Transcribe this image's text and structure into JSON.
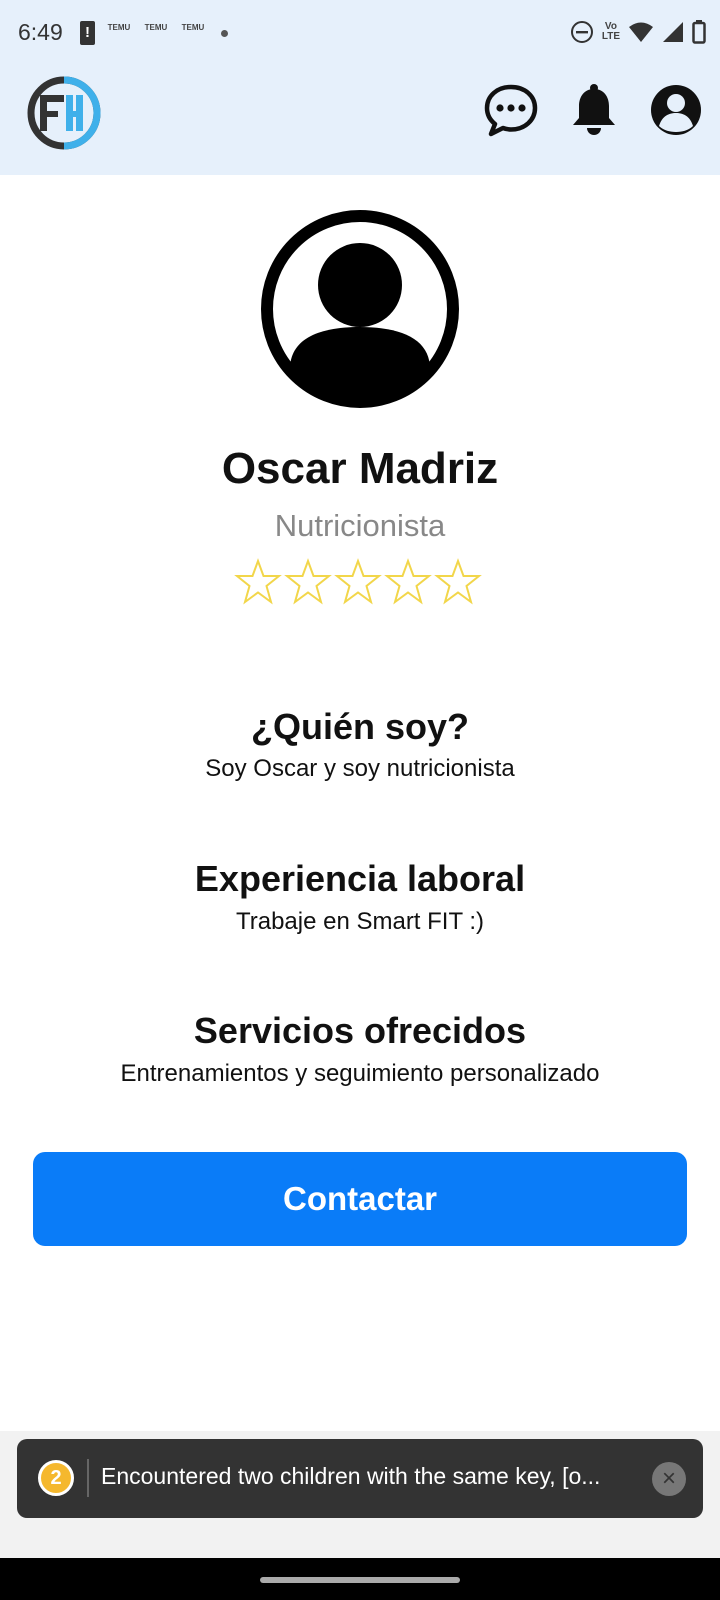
{
  "status_bar": {
    "time": "6:49",
    "battery_alert": "!",
    "temu_icon_label": "TEMU"
  },
  "header": {
    "logo_icon": "fh-logo-icon",
    "icons": [
      "chat-bubble-icon",
      "bell-icon",
      "user-circle-icon"
    ]
  },
  "profile": {
    "name": "Oscar Madriz",
    "role": "Nutricionista",
    "rating": 0,
    "rating_max": 5
  },
  "sections": {
    "about": {
      "title": "¿Quién soy?",
      "text": "Soy Oscar y soy nutricionista"
    },
    "experience": {
      "title": "Experiencia laboral",
      "text": "Trabaje en Smart FIT :)"
    },
    "services": {
      "title": "Servicios ofrecidos",
      "text": "Entrenamientos y seguimiento personalizado"
    }
  },
  "contact_button": {
    "label": "Contactar"
  },
  "toast": {
    "count": "2",
    "message": "Encountered two children with the same key, [o...",
    "close": "×"
  },
  "colors": {
    "header_bg": "#e6f0fb",
    "accent": "#0a7cf8",
    "star": "#f2d64a",
    "toast_bg": "#333333",
    "badge": "#f5b82e"
  }
}
